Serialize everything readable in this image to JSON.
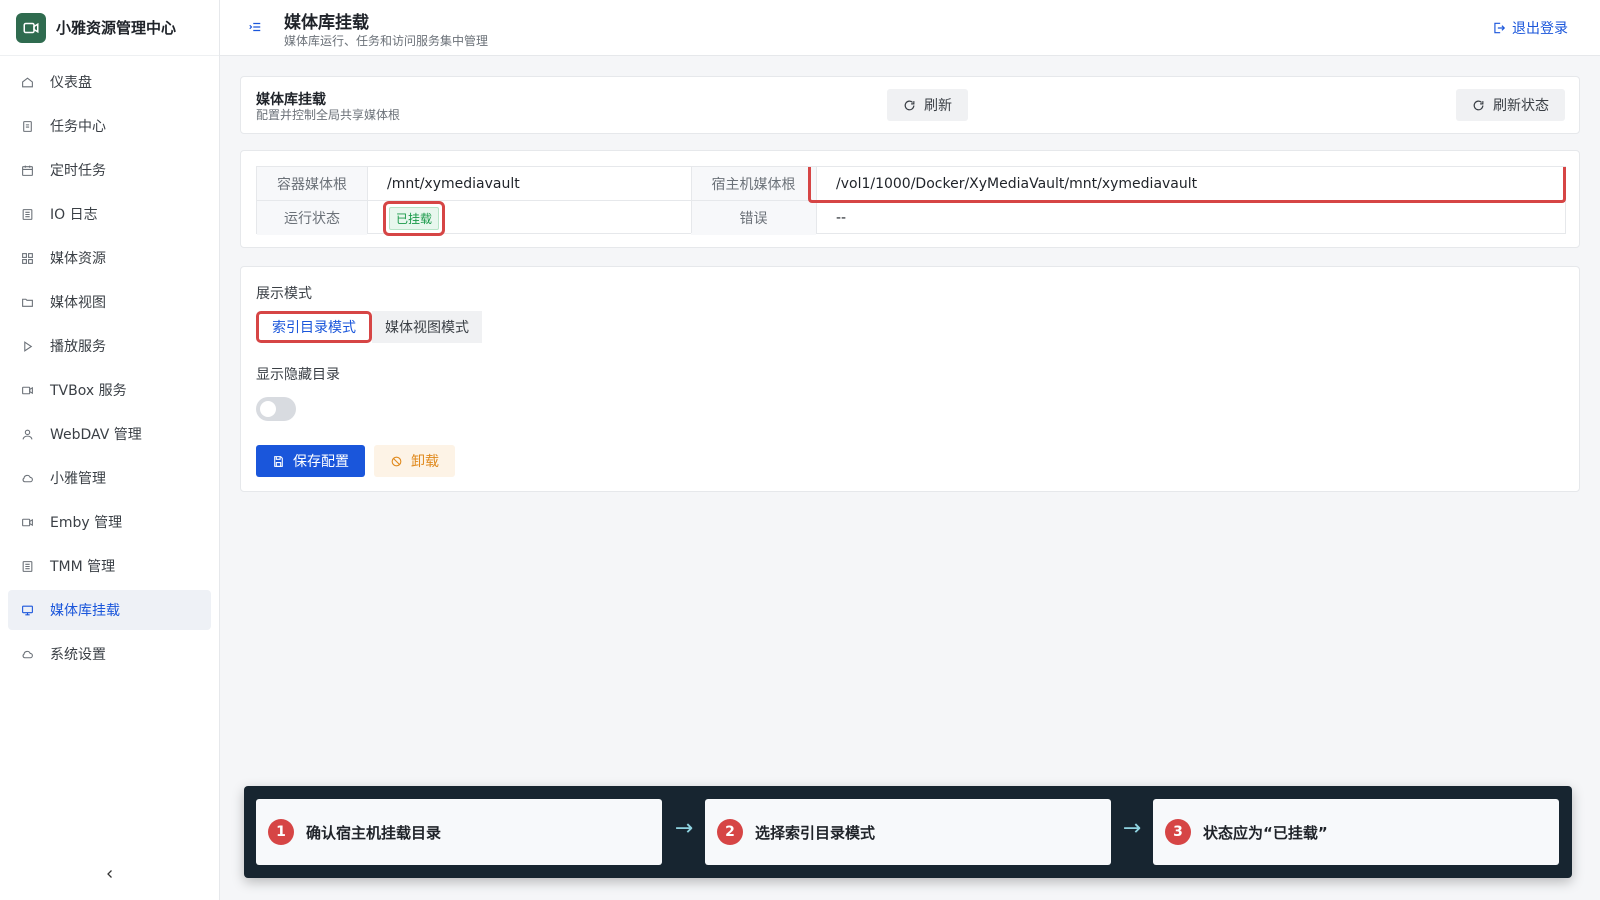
{
  "app": {
    "brand_title": "小雅资源管理中心"
  },
  "sidebar": {
    "items": [
      {
        "label": "仪表盘",
        "icon": "home-icon"
      },
      {
        "label": "任务中心",
        "icon": "document-icon"
      },
      {
        "label": "定时任务",
        "icon": "calendar-icon"
      },
      {
        "label": "IO 日志",
        "icon": "log-icon"
      },
      {
        "label": "媒体资源",
        "icon": "grid-icon"
      },
      {
        "label": "媒体视图",
        "icon": "folder-icon"
      },
      {
        "label": "播放服务",
        "icon": "play-icon"
      },
      {
        "label": "TVBox 服务",
        "icon": "video-icon"
      },
      {
        "label": "WebDAV 管理",
        "icon": "user-icon"
      },
      {
        "label": "小雅管理",
        "icon": "cloud-icon"
      },
      {
        "label": "Emby 管理",
        "icon": "video-icon"
      },
      {
        "label": "TMM 管理",
        "icon": "log-icon"
      },
      {
        "label": "媒体库挂载",
        "icon": "monitor-icon",
        "active": true
      },
      {
        "label": "系统设置",
        "icon": "cloud-icon"
      }
    ]
  },
  "header": {
    "title": "媒体库挂载",
    "subtitle": "媒体库运行、任务和访问服务集中管理",
    "logout_label": "退出登录"
  },
  "mount_card": {
    "title": "媒体库挂载",
    "subtitle": "配置并控制全局共享媒体根",
    "refresh_label": "刷新",
    "refresh_status_label": "刷新状态"
  },
  "info": {
    "container_root_label": "容器媒体根",
    "container_root_value": "/mnt/xymediavault",
    "host_root_label": "宿主机媒体根",
    "host_root_value": "/vol1/1000/Docker/XyMediaVault/mnt/xymediavault",
    "status_label": "运行状态",
    "status_value": "已挂载",
    "error_label": "错误",
    "error_value": "--"
  },
  "config": {
    "display_mode_label": "展示模式",
    "mode_options": [
      "索引目录模式",
      "媒体视图模式"
    ],
    "selected_mode": "索引目录模式",
    "show_hidden_label": "显示隐藏目录",
    "show_hidden_enabled": false,
    "save_label": "保存配置",
    "unmount_label": "卸载"
  },
  "guide": {
    "steps": [
      {
        "num": "1",
        "text": "确认宿主机挂载目录"
      },
      {
        "num": "2",
        "text": "选择索引目录模式"
      },
      {
        "num": "3",
        "text": "状态应为“已挂载”"
      }
    ],
    "arrow": "→"
  },
  "colors": {
    "primary": "#1a56db",
    "highlight": "#d64545",
    "success": "#1a9a4a",
    "warning": "#e08a1e",
    "brand_logo": "#2f6b4f",
    "guide_bg": "#172530"
  }
}
